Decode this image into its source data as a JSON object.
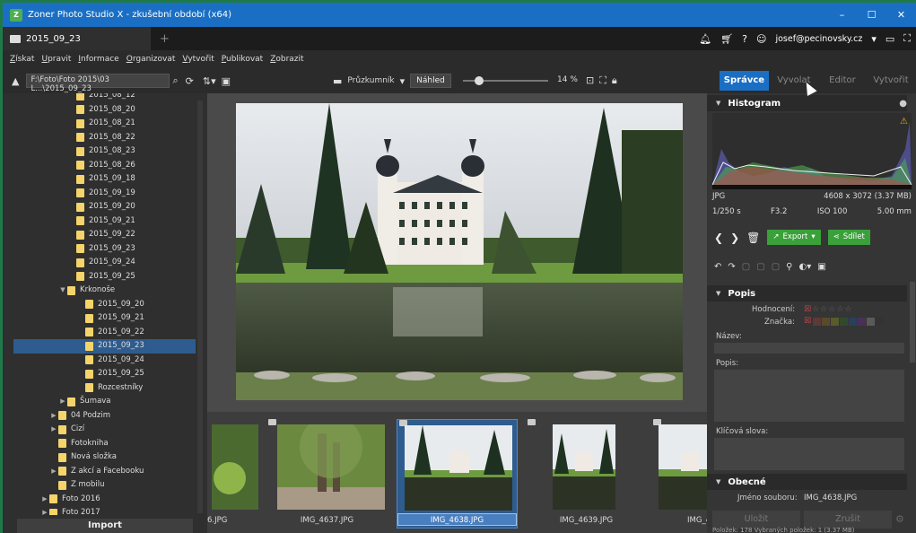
{
  "window": {
    "title": "Zoner Photo Studio X - zkušební období (x64)",
    "controls": {
      "minimize": "–",
      "maximize": "☐",
      "close": "✕"
    }
  },
  "tabbar": {
    "tab_label": "2015_09_23",
    "add_tab": "+",
    "user": "josef@pecinovsky.cz"
  },
  "menu": [
    "Získat",
    "Upravit",
    "Informace",
    "Organizovat",
    "Vytvořit",
    "Publikovat",
    "Zobrazit"
  ],
  "toolbar": {
    "path": "F:\\Foto\\Foto 2015\\03 L...\\2015_09_23",
    "explorer_label": "Průzkumník",
    "preview_label": "Náhled",
    "zoom": "14 %",
    "zoom_fraction": 0.14
  },
  "modules": [
    "Správce",
    "Vyvolat",
    "Editor",
    "Vytvořit"
  ],
  "tree": [
    {
      "label": "2015_08_12",
      "indent": 6,
      "exp": ""
    },
    {
      "label": "2015_08_20",
      "indent": 6,
      "exp": ""
    },
    {
      "label": "2015_08_21",
      "indent": 6,
      "exp": ""
    },
    {
      "label": "2015_08_22",
      "indent": 6,
      "exp": ""
    },
    {
      "label": "2015_08_23",
      "indent": 6,
      "exp": ""
    },
    {
      "label": "2015_08_26",
      "indent": 6,
      "exp": ""
    },
    {
      "label": "2015_09_18",
      "indent": 6,
      "exp": ""
    },
    {
      "label": "2015_09_19",
      "indent": 6,
      "exp": ""
    },
    {
      "label": "2015_09_20",
      "indent": 6,
      "exp": ""
    },
    {
      "label": "2015_09_21",
      "indent": 6,
      "exp": ""
    },
    {
      "label": "2015_09_22",
      "indent": 6,
      "exp": ""
    },
    {
      "label": "2015_09_23",
      "indent": 6,
      "exp": ""
    },
    {
      "label": "2015_09_24",
      "indent": 6,
      "exp": ""
    },
    {
      "label": "2015_09_25",
      "indent": 6,
      "exp": ""
    },
    {
      "label": "Krkonoše",
      "indent": 5,
      "exp": "▼"
    },
    {
      "label": "2015_09_20",
      "indent": 7,
      "exp": ""
    },
    {
      "label": "2015_09_21",
      "indent": 7,
      "exp": ""
    },
    {
      "label": "2015_09_22",
      "indent": 7,
      "exp": ""
    },
    {
      "label": "2015_09_23",
      "indent": 7,
      "exp": "",
      "selected": true
    },
    {
      "label": "2015_09_24",
      "indent": 7,
      "exp": ""
    },
    {
      "label": "2015_09_25",
      "indent": 7,
      "exp": ""
    },
    {
      "label": "Rozcestníky",
      "indent": 7,
      "exp": ""
    },
    {
      "label": "Šumava",
      "indent": 5,
      "exp": "▶"
    },
    {
      "label": "04 Podzim",
      "indent": 4,
      "exp": "▶"
    },
    {
      "label": "Cizí",
      "indent": 4,
      "exp": "▶"
    },
    {
      "label": "Fotokniha",
      "indent": 4,
      "exp": ""
    },
    {
      "label": "Nová složka",
      "indent": 4,
      "exp": ""
    },
    {
      "label": "Z akcí a Facebooku",
      "indent": 4,
      "exp": "▶"
    },
    {
      "label": "Z mobilu",
      "indent": 4,
      "exp": ""
    },
    {
      "label": "Foto 2016",
      "indent": 3,
      "exp": "▶"
    },
    {
      "label": "Foto 2017",
      "indent": 3,
      "exp": "▶"
    }
  ],
  "import_label": "Import",
  "filmstrip": [
    {
      "name": "6.JPG",
      "selected": false
    },
    {
      "name": "IMG_4637.JPG",
      "selected": false
    },
    {
      "name": "IMG_4638.JPG",
      "selected": true
    },
    {
      "name": "IMG_4639.JPG",
      "selected": false
    },
    {
      "name": "IMG_4",
      "selected": false
    }
  ],
  "histogram": {
    "title": "Histogram",
    "format": "JPG",
    "dimensions": "4608 x 3072 (3.37 MB)",
    "shutter": "1/250 s",
    "aperture": "F3.2",
    "iso": "ISO 100",
    "focal": "5.00 mm"
  },
  "actions": {
    "export": "Export",
    "share": "Sdílet"
  },
  "popis": {
    "title": "Popis",
    "rating_label": "Hodnocení:",
    "tag_label": "Značka:",
    "name_label": "Název:",
    "desc_label": "Popis:",
    "keywords_label": "Klíčová slova:",
    "colors": [
      "#5a3a3a",
      "#5a4a2a",
      "#5a5a2a",
      "#2f4a2f",
      "#2a3f5a",
      "#4a2f5a",
      "#5a5a5a",
      "#333333"
    ]
  },
  "obecne": {
    "title": "Obecné",
    "filename_label": "Jméno souboru:",
    "filename": "IMG_4638.JPG"
  },
  "bottom": {
    "save": "Uložit",
    "discard": "Zrušit",
    "status": "Položek: 178 Vybraných položek: 1 (3.37 MB)"
  }
}
